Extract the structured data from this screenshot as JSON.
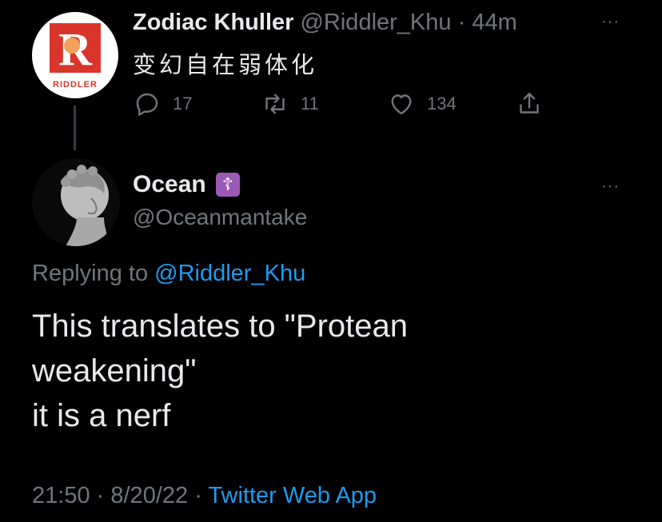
{
  "parent_tweet": {
    "display_name": "Zodiac Khuller",
    "handle": "@Riddler_Khu",
    "separator": "·",
    "time_ago": "44m",
    "text": "变幻自在弱体化",
    "avatar_logo_letter": "R",
    "avatar_logo_text": "RIDDLER",
    "more_label": "···",
    "actions": {
      "reply_count": "17",
      "retweet_count": "11",
      "like_count": "134"
    }
  },
  "reply_tweet": {
    "display_name": "Ocean",
    "badge_symbol": "☦",
    "handle": "@Oceanmantake",
    "more_label": "···",
    "replying_to_prefix": "Replying to",
    "replying_to_handle": "@Riddler_Khu",
    "text_lines": [
      "This translates to \"Protean",
      "weakening\"",
      "it is a nerf"
    ],
    "time": "21:50",
    "date": "8/20/22",
    "separator": "·",
    "source": "Twitter Web App"
  },
  "colors": {
    "background": "#000000",
    "text": "#e7e9ea",
    "muted": "#71767b",
    "link": "#1d9bf0",
    "riddler_red": "#d9352b",
    "badge_purple": "#9b59b6"
  }
}
